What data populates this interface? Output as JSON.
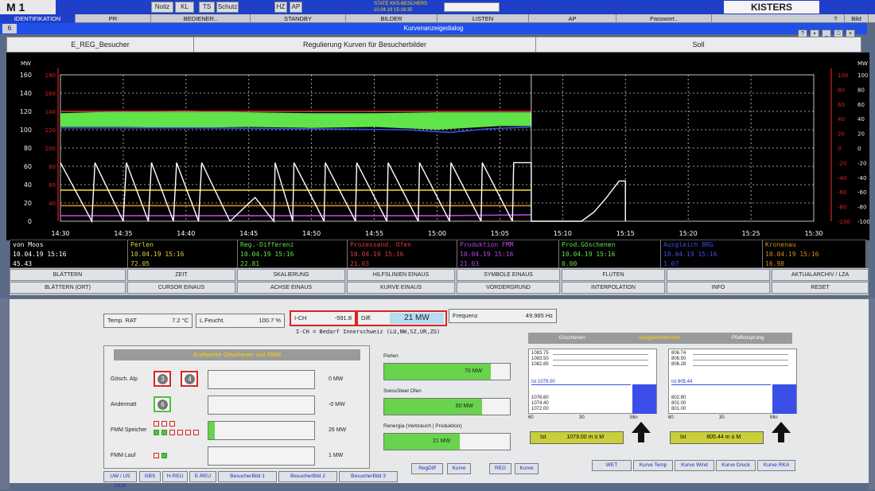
{
  "top": {
    "logo": "M 1",
    "buttons": [
      "Notiz",
      "KL",
      "TS",
      "Schutz",
      "HZ",
      "AP"
    ],
    "status_line1": "STATE KKS-BESCHERS",
    "status_line2": "10.04.19 15:16:35",
    "brand": "KISTERS"
  },
  "menu": [
    "IDENTIFIKATION",
    "PR",
    "BEDIENER..",
    "STANDBY",
    "BILDER",
    "LISTEN",
    "AP",
    "Passwort..",
    "?",
    "Bild"
  ],
  "dialog": {
    "number": "6",
    "title": "Kurvenanzeigedialog"
  },
  "header": {
    "name": "E_REG_Besucher",
    "description": "Regulierung Kurven für Besucherbilder",
    "mode": "Soll"
  },
  "chart_data": {
    "type": "line",
    "xlabels": [
      "14:30",
      "14:35",
      "14:40",
      "14:45",
      "14:50",
      "14:55",
      "15:00",
      "15:05",
      "15:10",
      "15:15",
      "15:20",
      "15:25",
      "15:30"
    ],
    "y_left_ticks": [
      "160",
      "140",
      "120",
      "100",
      "80",
      "60",
      "40",
      "20",
      "0"
    ],
    "y_left_unit": "MW",
    "y_left_secondary": [
      "180",
      "160",
      "140",
      "120",
      "100",
      "80",
      "60",
      "40"
    ],
    "y_right_ticks": [
      "100",
      "80",
      "60",
      "40",
      "20",
      "0",
      "-20",
      "-40",
      "-60",
      "-80",
      "-100"
    ],
    "y_right_unit": "MW",
    "ylim": [
      0,
      160
    ],
    "series": [
      {
        "name": "Perlen",
        "color": "#e4cf2e",
        "points": [
          [
            0,
            34
          ],
          [
            0.6,
            34
          ],
          [
            1.5,
            34
          ],
          [
            2.5,
            34
          ],
          [
            3.5,
            34
          ],
          [
            4.5,
            34
          ],
          [
            5.5,
            34
          ],
          [
            6.5,
            34
          ],
          [
            7.5,
            34
          ]
        ]
      },
      {
        "name": "Reg.-Differenz",
        "color": "#5fe44a",
        "band": [
          [
            0,
            103,
            118
          ],
          [
            1,
            103,
            120
          ],
          [
            2,
            102,
            121
          ],
          [
            3,
            103,
            119
          ],
          [
            4,
            102,
            118
          ],
          [
            5,
            103,
            118
          ],
          [
            6,
            100,
            119
          ],
          [
            7,
            104,
            119
          ],
          [
            7.5,
            104,
            119
          ]
        ]
      },
      {
        "name": "Prozessend. Ofen",
        "color": "#e23a3a",
        "points": [
          [
            0,
            120
          ],
          [
            7.5,
            120
          ]
        ]
      },
      {
        "name": "Produktion FMM",
        "color": "#3b4fe8",
        "points": [
          [
            0,
            102
          ],
          [
            2,
            102
          ],
          [
            4,
            101
          ],
          [
            5.5,
            100
          ],
          [
            6.2,
            97
          ],
          [
            6.8,
            101
          ],
          [
            7.5,
            103
          ]
        ]
      },
      {
        "name": "Prod.Göschenen",
        "color": "#b944e8",
        "points": [
          [
            0,
            6
          ],
          [
            3,
            6
          ],
          [
            6,
            6
          ],
          [
            7.5,
            7
          ]
        ]
      },
      {
        "name": "Kronenau",
        "color": "#d58a1a",
        "points": [
          [
            0,
            17
          ],
          [
            3,
            17
          ],
          [
            6,
            17
          ],
          [
            7.5,
            17
          ]
        ]
      },
      {
        "name": "von Moos",
        "color": "#ffffff",
        "steps": [
          [
            0,
            64
          ],
          [
            0.5,
            0
          ],
          [
            0.55,
            64
          ],
          [
            1,
            0
          ],
          [
            1.05,
            64
          ],
          [
            1.4,
            0
          ],
          [
            1.45,
            64
          ],
          [
            1.8,
            0
          ],
          [
            1.85,
            64
          ],
          [
            2.2,
            0
          ],
          [
            2.25,
            64
          ],
          [
            2.7,
            0
          ],
          [
            3.1,
            26
          ],
          [
            3.4,
            0
          ],
          [
            3.42,
            64
          ],
          [
            3.7,
            0
          ],
          [
            3.72,
            64
          ],
          [
            4.2,
            0
          ],
          [
            4.22,
            64
          ],
          [
            4.7,
            0
          ],
          [
            4.72,
            64
          ],
          [
            5.2,
            0
          ],
          [
            5.22,
            64
          ],
          [
            5.7,
            0
          ],
          [
            5.72,
            64
          ],
          [
            6.2,
            0
          ],
          [
            6.22,
            64
          ],
          [
            6.7,
            0
          ],
          [
            6.72,
            64
          ],
          [
            7.2,
            0
          ],
          [
            7.22,
            64
          ],
          [
            7.5,
            64
          ],
          [
            7.5,
            0
          ],
          [
            8.3,
            0
          ],
          [
            8.5,
            10
          ],
          [
            8.7,
            26
          ],
          [
            8.9,
            44
          ],
          [
            9.0,
            44
          ],
          [
            9.0,
            0
          ]
        ]
      }
    ]
  },
  "legend": [
    {
      "name": "von Moos",
      "time": "10.04.19 15:16",
      "value": "45.43",
      "color": "#ffffff"
    },
    {
      "name": "Perlen",
      "time": "10.04.19 15:16",
      "value": "72.05",
      "color": "#e4cf2e"
    },
    {
      "name": "Reg.-Differenz",
      "time": "10.04.19 15:16",
      "value": "22.81",
      "color": "#5fe44a"
    },
    {
      "name": "Prozessend. Ofen",
      "time": "10.04.19 15:16",
      "value": "21.03",
      "color": "#e23a3a"
    },
    {
      "name": "Produktion FMM",
      "time": "10.04.19 15:16",
      "value": "21.03",
      "color": "#b944e8"
    },
    {
      "name": "Prod.Göschenen",
      "time": "10.04.19 15:16",
      "value": "0.00",
      "color": "#5fe44a"
    },
    {
      "name": "Ausgleich BRG",
      "time": "10.04.19 15:16",
      "value": "1.07",
      "color": "#3b4fe8"
    },
    {
      "name": "Kronenau",
      "time": "10.04.19 15:16",
      "value": "16.98",
      "color": "#d58a1a"
    }
  ],
  "buttons_row1": [
    "BLÄTTERN",
    "ZEIT",
    "SKALIERUNG",
    "HILFSLINIEN EINAUS",
    "SYMBOLE EINAUS",
    "FLUTEN",
    "",
    "AKTUALARCHIV / LZA"
  ],
  "buttons_row2": [
    "BLÄTTERN (ORT)",
    "CURSOR EINAUS",
    "ACHSE EINAUS",
    "KURVE EINAUS",
    "VORDERGRUND",
    "INTERPOLATION",
    "INFO",
    "RESET"
  ],
  "measurements": {
    "temp_label": "Temp. RAT",
    "temp_value": "7.2 °C",
    "humid_label": "L.Feucht.",
    "humid_value": "100.7 %",
    "ich_label": "I-CH",
    "ich_value": "-591.8",
    "diff_label": "Diff.",
    "diff_value": "21 MW",
    "freq_label": "Frequenz",
    "freq_value": "49.985 Hz",
    "note": "I-CH = Bedarf Innerschweiz (LU,NW,SZ,UR,ZG)"
  },
  "plants": {
    "title": "Kraftwerke Göschenen und FMM",
    "rows": [
      {
        "label": "Gösch. Alp",
        "units": [
          "3",
          "4"
        ],
        "value": "0 MW",
        "fill": 0
      },
      {
        "label": "Andermatt",
        "units": [
          "6"
        ],
        "value": "-0 MW",
        "fill": 0
      },
      {
        "label": "FMM Speicher",
        "units": [],
        "value": "26 MW",
        "fill": 0.06
      },
      {
        "label": "FMM Lauf",
        "units": [],
        "value": "1 MW",
        "fill": 0
      }
    ]
  },
  "consumers": [
    {
      "label": "Perlen",
      "value": "70 MW",
      "fill": 0.85
    },
    {
      "label": "SwissSteel Ofen",
      "value": "60 MW",
      "fill": 0.78
    },
    {
      "label": "Renergia (Verbrauch | Produktion)",
      "value": "21 MW",
      "fill": 0.6
    }
  ],
  "reservoirs": {
    "tabs": [
      "Göschenen",
      "Ausgleichsbecken",
      "Pfaffensprung"
    ],
    "left": {
      "levels": [
        "1083.75",
        "1083.50",
        "1082.85"
      ],
      "ist": "Ist 1079.00",
      "lower": [
        "1076.60",
        "1074.40",
        "1072.00"
      ],
      "axis": [
        "60",
        "30",
        "Min"
      ],
      "readout_label": "Ist",
      "readout_value": "1079.00 m ü M"
    },
    "right": {
      "levels": [
        "806.74",
        "806.50",
        "806.28"
      ],
      "ist": "Ist 805.44",
      "lower": [
        "802.80",
        "802.00",
        "801.00"
      ],
      "axis": [
        "60",
        "30",
        "Min"
      ],
      "readout_label": "Ist",
      "readout_value": "805.44 m ü M"
    }
  },
  "bottom_buttons": [
    "RegDiff",
    "Kurve",
    "REG",
    "Kurve"
  ],
  "right_buttons": [
    "WET",
    "Kurve Temp",
    "Kurve Wind",
    "Kurve Druck",
    "Kurve RKA"
  ],
  "footer_buttons": [
    "UW / US CKW",
    "GBS",
    "H-REU",
    "E-REU",
    "BesucherBild 1",
    "BesucherBild 2",
    "BesucherBild 3"
  ],
  "colors": {
    "accent": "#1f3fc8",
    "chart_bg": "#000000",
    "green_bar": "#68d34c",
    "warn_red": "#d22222"
  }
}
